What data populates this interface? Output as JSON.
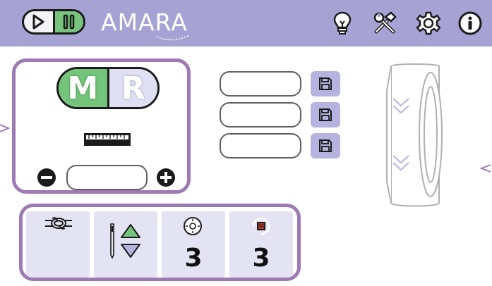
{
  "header": {
    "title": "AMARA",
    "icons": [
      "play-icon",
      "pause-icon",
      "lightbulb-icon",
      "tools-icon",
      "gear-icon",
      "info-icon"
    ]
  },
  "stitch_panel": {
    "mode_left": "M",
    "mode_right": "R",
    "active_mode": "M",
    "length_value": ""
  },
  "presets": [
    {
      "value": ""
    },
    {
      "value": ""
    },
    {
      "value": ""
    }
  ],
  "settings": {
    "tension_value": "3",
    "bobbin_value": "3"
  },
  "colors": {
    "header": "#a6a2d3",
    "panel_border": "#9e7ab3",
    "accent_green": "#74c47c",
    "accent_lavender": "#b7b3e0",
    "tile": "#e3e3f3"
  }
}
